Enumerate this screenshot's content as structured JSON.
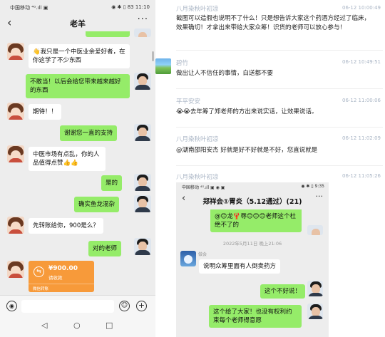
{
  "left_chat": {
    "status_left": "中国移动 ⁴ᴳ.ıll ▣",
    "status_right": "◉ ✱ ▯ 83 11:10",
    "back_icon": "‹",
    "title": "老羊",
    "more_icon": "···",
    "messages": [
      {
        "side": "left",
        "text": "👋我只是一个中医业余爱好者，在你这学了不少东西"
      },
      {
        "side": "right",
        "text": "不敢当！以后会给您带来越来越好的东西"
      },
      {
        "side": "left",
        "text": "期待！！"
      },
      {
        "side": "right",
        "text": "谢谢您一直的支持"
      },
      {
        "side": "left",
        "text": "中医市场有点乱，你的人品值得点赞👍👍"
      },
      {
        "side": "right",
        "text": "是的"
      },
      {
        "side": "right",
        "text": "确实鱼龙混杂"
      },
      {
        "side": "left",
        "text": "先转账给你，900是么？"
      },
      {
        "side": "right",
        "text": "对的老师"
      }
    ],
    "transfer": {
      "icon": "⇆",
      "amount": "¥900.00",
      "status": "请收款",
      "footer": "微信转账"
    },
    "input_bar": {
      "voice_icon": "◉",
      "emoji_icon": "☺",
      "plus_icon": "+"
    },
    "nav": {
      "back": "◁",
      "home": "○",
      "recent": "□"
    }
  },
  "comments": [
    {
      "name": "八月染秋叶初凉",
      "time": "06-12 10:00:49",
      "text": "截图可以造假也说明不了什么！只是想告诉大家这个药酒方经过了临床，效果确切！才拿出来带给大家众筹！识货的老师可以放心参与！"
    },
    {
      "name": "碧竹",
      "time": "06-12 10:49:51",
      "text": "做出让人不信任的事情，白送都不要"
    },
    {
      "name": "平平安安",
      "time": "06-12 11:00:06",
      "text": "😭😭去年筹了郑老师的方出来说实话，让效果说话。"
    },
    {
      "name": "八月染秋叶初凉",
      "time": "06-12 11:02:09",
      "text": "@湖南邵阳安杰 好就是好不好就是不好，您直说就是"
    },
    {
      "name": "八月染秋叶初凉",
      "time": "06-12 11:05:26",
      "text": ""
    }
  ],
  "inner_chat": {
    "status_left": "中国移动 ⁴ᴳ.ıll ▣ ◉ ▣",
    "status_right": "◉ ✱ ▯ 9:35",
    "back_icon": "‹",
    "title": "郑祥会①胃炎（5.12通过）(21)",
    "more_icon": "···",
    "top_bubble": "@😊龙🦞辱😊😊😊老师这个杜绝不了的",
    "timestamp": "2022年5月11日 晚上21:06",
    "sender": "做会",
    "messages": [
      {
        "side": "left",
        "text": "说明众筹里面有人倒卖药方"
      },
      {
        "side": "right",
        "text": "这个不好说！"
      },
      {
        "side": "right",
        "text": "这个给了大家！也没有权利约束每个老师得意愿"
      }
    ]
  }
}
